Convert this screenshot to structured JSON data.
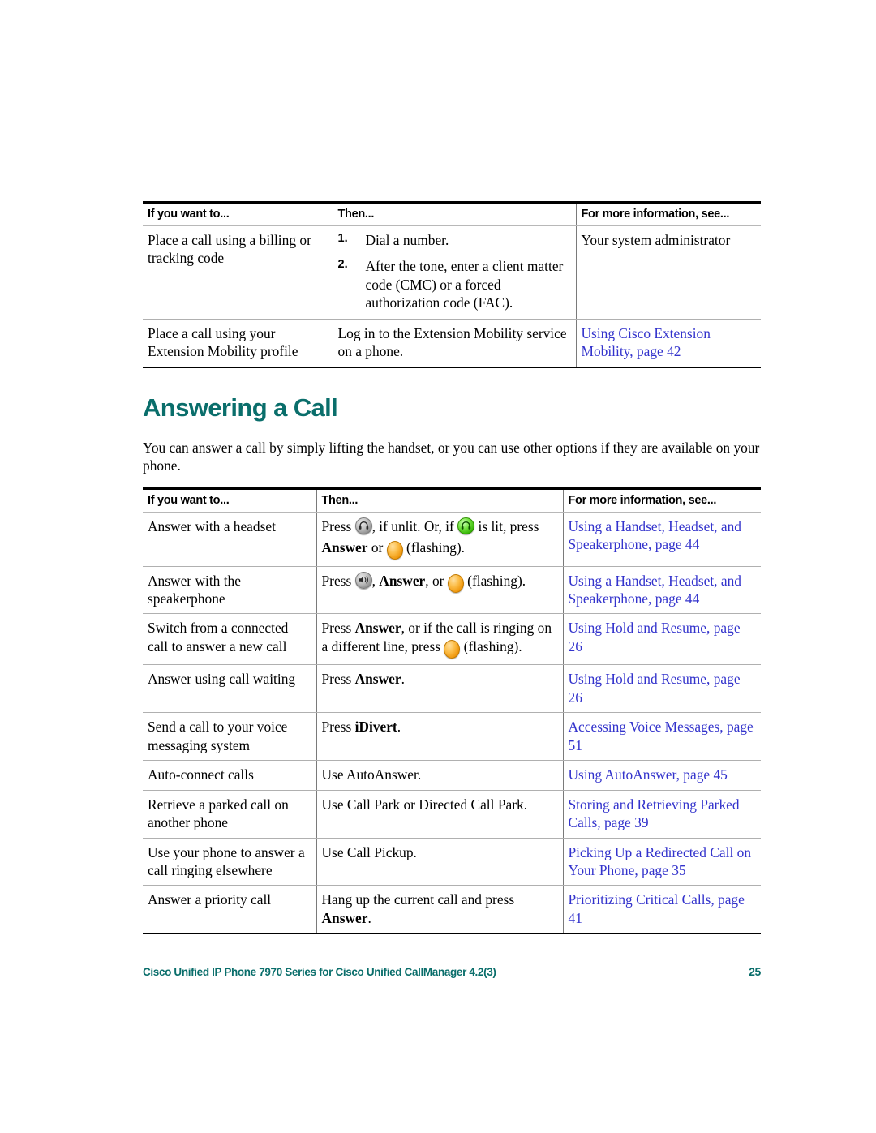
{
  "document": {
    "footer_text": "Cisco Unified IP Phone 7970 Series for Cisco Unified CallManager 4.2(3)",
    "page_number": "25",
    "accent_color": "#0a6e6b",
    "link_color": "#3333cc"
  },
  "table_top": {
    "headers": [
      "If you want to...",
      "Then...",
      "For more information, see..."
    ],
    "rows": [
      {
        "want": "Place a call using a billing or tracking code",
        "steps": [
          {
            "num": "1.",
            "text": "Dial a number."
          },
          {
            "num": "2.",
            "text": "After the tone, enter a client matter code (CMC) or a forced authorization code (FAC)."
          }
        ],
        "info": "Your system administrator",
        "info_is_link": false
      },
      {
        "want": "Place a call using your Extension Mobility profile",
        "then": "Log in to the Extension Mobility service on a phone.",
        "info": "Using Cisco Extension Mobility, page 42",
        "info_is_link": true
      }
    ]
  },
  "section": {
    "title": "Answering a Call",
    "intro": "You can answer a call by simply lifting the handset, or you can use other options if they are available on your phone."
  },
  "table_answer": {
    "headers": [
      "If you want to...",
      "Then...",
      "For more information, see..."
    ],
    "rows": [
      {
        "want": "Answer with a headset",
        "then_parts": [
          {
            "type": "text",
            "value": "Press "
          },
          {
            "type": "icon",
            "value": "headset-button-unlit-icon"
          },
          {
            "type": "text",
            "value": ", if unlit. Or, if "
          },
          {
            "type": "icon",
            "value": "headset-button-lit-icon"
          },
          {
            "type": "text",
            "value": " is lit, press "
          },
          {
            "type": "bold",
            "value": "Answer"
          },
          {
            "type": "text",
            "value": " or "
          },
          {
            "type": "icon",
            "value": "line-button-flashing-icon"
          },
          {
            "type": "text",
            "value": " (flashing)."
          }
        ],
        "info": "Using a Handset, Headset, and Speakerphone, page 44",
        "info_is_link": true
      },
      {
        "want": "Answer with the speakerphone",
        "then_parts": [
          {
            "type": "text",
            "value": "Press "
          },
          {
            "type": "icon",
            "value": "speakerphone-button-icon"
          },
          {
            "type": "text",
            "value": ", "
          },
          {
            "type": "bold",
            "value": "Answer"
          },
          {
            "type": "text",
            "value": ", or "
          },
          {
            "type": "icon",
            "value": "line-button-flashing-icon"
          },
          {
            "type": "text",
            "value": " (flashing)."
          }
        ],
        "info": "Using a Handset, Headset, and Speakerphone, page 44",
        "info_is_link": true
      },
      {
        "want": "Switch from a connected call to answer a new call",
        "then_parts": [
          {
            "type": "text",
            "value": "Press "
          },
          {
            "type": "bold",
            "value": "Answer"
          },
          {
            "type": "text",
            "value": ", or if the call is ringing on a different line, press "
          },
          {
            "type": "icon",
            "value": "line-button-flashing-icon"
          },
          {
            "type": "text",
            "value": " (flashing)."
          }
        ],
        "info": "Using Hold and Resume, page 26",
        "info_is_link": true
      },
      {
        "want": "Answer using call waiting",
        "then_parts": [
          {
            "type": "text",
            "value": "Press "
          },
          {
            "type": "bold",
            "value": "Answer"
          },
          {
            "type": "text",
            "value": "."
          }
        ],
        "info": "Using Hold and Resume, page 26",
        "info_is_link": true
      },
      {
        "want": "Send a call to your voice messaging system",
        "then_parts": [
          {
            "type": "text",
            "value": "Press "
          },
          {
            "type": "bold",
            "value": "iDivert"
          },
          {
            "type": "text",
            "value": "."
          }
        ],
        "info": "Accessing Voice Messages, page 51",
        "info_is_link": true
      },
      {
        "want": "Auto-connect calls",
        "then_parts": [
          {
            "type": "text",
            "value": "Use AutoAnswer."
          }
        ],
        "info": "Using AutoAnswer, page 45",
        "info_is_link": true
      },
      {
        "want": "Retrieve a parked call on another phone",
        "then_parts": [
          {
            "type": "text",
            "value": "Use Call Park or Directed Call Park."
          }
        ],
        "info": "Storing and Retrieving Parked Calls, page 39",
        "info_is_link": true
      },
      {
        "want": "Use your phone to answer a call ringing elsewhere",
        "then_parts": [
          {
            "type": "text",
            "value": "Use Call Pickup."
          }
        ],
        "info": "Picking Up a Redirected Call on Your Phone, page 35",
        "info_is_link": true
      },
      {
        "want": "Answer a priority call",
        "then_parts": [
          {
            "type": "text",
            "value": "Hang up the current call and press "
          },
          {
            "type": "bold",
            "value": "Answer"
          },
          {
            "type": "text",
            "value": "."
          }
        ],
        "info": "Prioritizing Critical Calls, page 41",
        "info_is_link": true
      }
    ]
  }
}
